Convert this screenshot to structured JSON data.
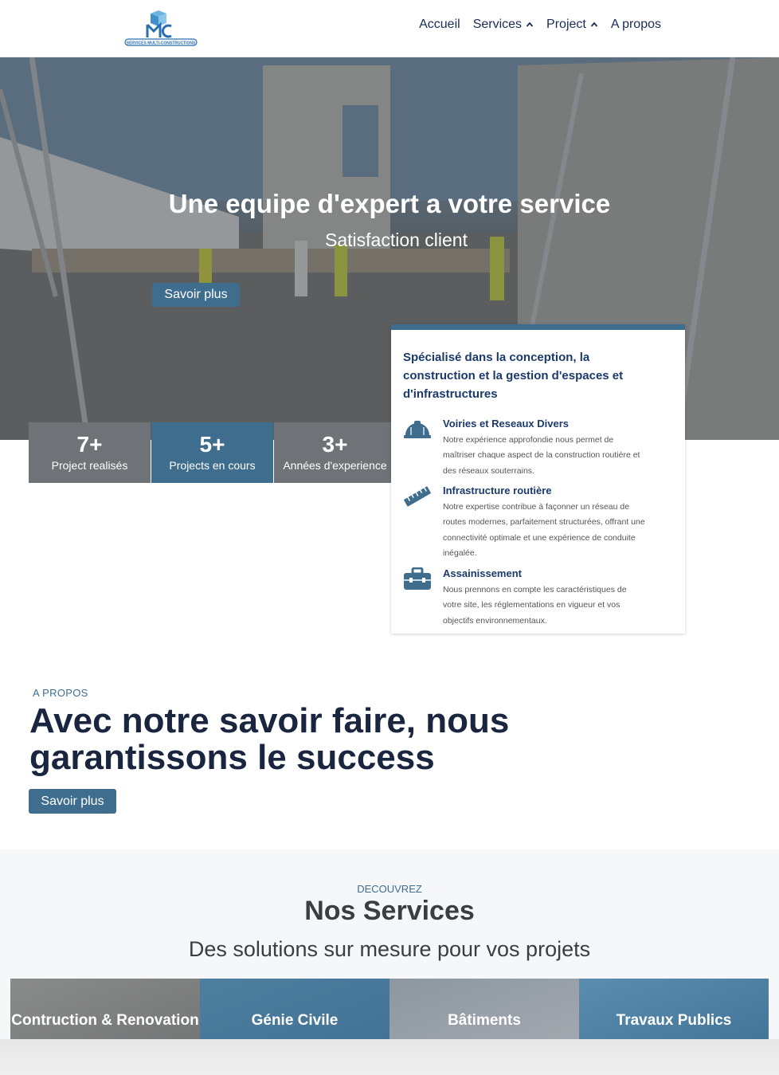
{
  "header": {
    "logo_text": "SERVICES MULTI-CONSTRUCTIONS",
    "nav": [
      {
        "label": "Accueil",
        "icon": ""
      },
      {
        "label": "Services",
        "icon": "chevron-up-icon"
      },
      {
        "label": "Project",
        "icon": "chevron-up-icon"
      },
      {
        "label": "A propos",
        "icon": ""
      }
    ]
  },
  "hero": {
    "title": "Une equipe d'expert a votre service",
    "subtitle": "Satisfaction client",
    "button": "Savoir plus"
  },
  "stats": [
    {
      "value": "7+",
      "label": "Project realisés"
    },
    {
      "value": "5+",
      "label": "Projects en cours"
    },
    {
      "value": "3+",
      "label": "Années d'experience"
    }
  ],
  "card": {
    "title": "Spécialisé dans la conception, la construction et la gestion d'espaces et d'infrastructures",
    "items": [
      {
        "icon": "hard-hat-icon",
        "title": "Voiries et Reseaux Divers",
        "desc": "Notre expérience approfondie nous permet de maîtriser chaque aspect de la construction routière et des réseaux souterrains."
      },
      {
        "icon": "ruler-icon",
        "title": "Infrastructure routière",
        "desc": "Notre expertise contribue à façonner un réseau de routes modernes, parfaitement structurées, offrant une connectivité optimale et une expérience de conduite inégalée."
      },
      {
        "icon": "toolbox-icon",
        "title": "Assainissement",
        "desc": "Nous prennons en compte les caractéristiques de votre site, les réglementations en vigueur et vos objectifs environnementaux."
      }
    ]
  },
  "about": {
    "eyebrow": "A PROPOS",
    "title": "Avec notre savoir faire, nous garantissons le success",
    "button": "Savoir plus"
  },
  "services": {
    "eyebrow": "DECOUVREZ",
    "title": "Nos Services",
    "subtitle": "Des solutions sur mesure pour vos projets",
    "tiles": [
      {
        "label": "Contruction & Renovation"
      },
      {
        "label": "Génie Civile"
      },
      {
        "label": "Bâtiments"
      },
      {
        "label": "Travaux Publics"
      }
    ]
  },
  "colors": {
    "primary": "#3e6d8e",
    "navy": "#1b3a6b",
    "gray_stat": "#6f7378"
  }
}
